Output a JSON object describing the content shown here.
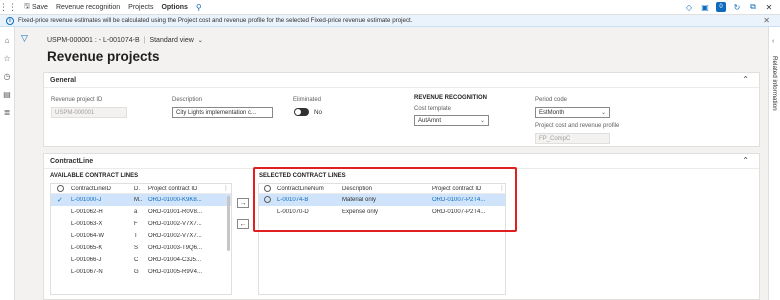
{
  "toolbar": {
    "save": "Save",
    "revenue_recognition": "Revenue recognition",
    "projects": "Projects",
    "options": "Options",
    "badge_count": "0"
  },
  "info_bar": {
    "message": "Fixed-price revenue estimates will be calculated using the Project cost and revenue profile for the selected Fixed-price revenue estimate project."
  },
  "page": {
    "breadcrumb_record": "USPM-000001 : - L-001074-B",
    "view": "Standard view",
    "title": "Revenue projects"
  },
  "right_rail": {
    "label": "Related information"
  },
  "general": {
    "header": "General",
    "revenue_project_id_label": "Revenue project ID",
    "revenue_project_id_value": "USPM-000001",
    "description_label": "Description",
    "description_value": "City Lights implementation c...",
    "eliminated_label": "Eliminated",
    "eliminated_value": "No",
    "revenue_recognition_header": "REVENUE RECOGNITION",
    "cost_template_label": "Cost template",
    "cost_template_value": "AutAmnt",
    "period_code_label": "Period code",
    "period_code_value": "EstMonth",
    "profile_label": "Project cost and revenue profile",
    "profile_value": "FP_CompC"
  },
  "contract_line": {
    "header": "ContractLine",
    "available": {
      "title": "AVAILABLE CONTRACT LINES",
      "columns": [
        "ContractLineID",
        "D.",
        "Project contract ID"
      ],
      "rows": [
        {
          "id": "L-001000-J",
          "d": "M..",
          "contract": "ORD-01000-K9K8...",
          "selected": true
        },
        {
          "id": "L-001062-H",
          "d": "a",
          "contract": "ORD-01001-R0V8...",
          "selected": false
        },
        {
          "id": "L-001063-X",
          "d": "F",
          "contract": "ORD-01002-V7X7...",
          "selected": false
        },
        {
          "id": "L-001064-W",
          "d": "T",
          "contract": "ORD-01002-V7X7...",
          "selected": false
        },
        {
          "id": "L-001065-K",
          "d": "S",
          "contract": "ORD-01003-T9Q6...",
          "selected": false
        },
        {
          "id": "L-001066-J",
          "d": "C",
          "contract": "ORD-01004-C3J5...",
          "selected": false
        },
        {
          "id": "L-001067-N",
          "d": "G",
          "contract": "ORD-01005-R9V4...",
          "selected": false
        }
      ]
    },
    "selected": {
      "title": "SELECTED CONTRACT LINES",
      "columns": [
        "ContractLineNum",
        "Description",
        "Project contract ID"
      ],
      "rows": [
        {
          "id": "L-001074-B",
          "description": "Material only",
          "contract": "ORD-01007-P2T4...",
          "selected": true
        },
        {
          "id": "L-001070-D",
          "description": "Expense only",
          "contract": "ORD-01007-P2T4...",
          "selected": false
        }
      ]
    },
    "move_right": "→",
    "move_left": "←"
  },
  "colors": {
    "accent": "#0f6cbd",
    "highlight": "#e02020",
    "selected_row": "#cfe4fa"
  }
}
